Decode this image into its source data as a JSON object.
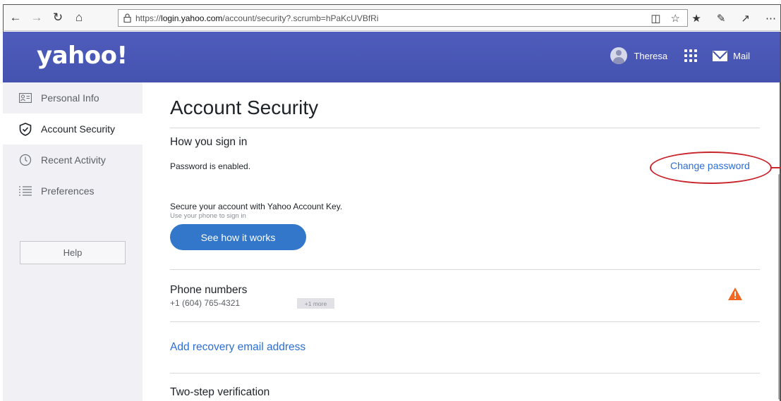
{
  "browser": {
    "url_prefix": "https://",
    "url_host": "login.yahoo.com",
    "url_path": "/account/security?.scrumb=hPaKcUVBfRi",
    "icons": [
      "back-arrow-icon",
      "forward-arrow-icon",
      "refresh-icon",
      "home-icon",
      "lock-icon",
      "reading-view-icon",
      "favorite-star-icon",
      "favorites-list-icon",
      "pen-icon",
      "share-icon",
      "more-icon"
    ]
  },
  "header": {
    "logo": "yahoo!",
    "user_name": "Theresa",
    "mail_label": "Mail"
  },
  "sidebar": {
    "items": [
      {
        "label": "Personal Info",
        "icon": "id-card-icon",
        "active": false
      },
      {
        "label": "Account Security",
        "icon": "shield-icon",
        "active": true
      },
      {
        "label": "Recent Activity",
        "icon": "clock-icon",
        "active": false
      },
      {
        "label": "Preferences",
        "icon": "list-icon",
        "active": false
      }
    ],
    "help_label": "Help"
  },
  "main": {
    "title": "Account Security",
    "sign_in": {
      "heading": "How you sign in",
      "password_status": "Password is enabled.",
      "change_password": "Change password",
      "account_key_text": "Secure your account with Yahoo Account Key.",
      "account_key_sub": "Use your phone to sign in",
      "see_how_button": "See how it works"
    },
    "phone": {
      "heading": "Phone numbers",
      "number": "+1 (604) 765-4321",
      "more_badge": "+1 more",
      "status_icon": "warning-icon",
      "status_color": "#f26722"
    },
    "recovery_email": {
      "link": "Add recovery email address"
    },
    "two_step": {
      "heading": "Two-step verification"
    }
  },
  "annotation": {
    "color": "#c9242b"
  }
}
